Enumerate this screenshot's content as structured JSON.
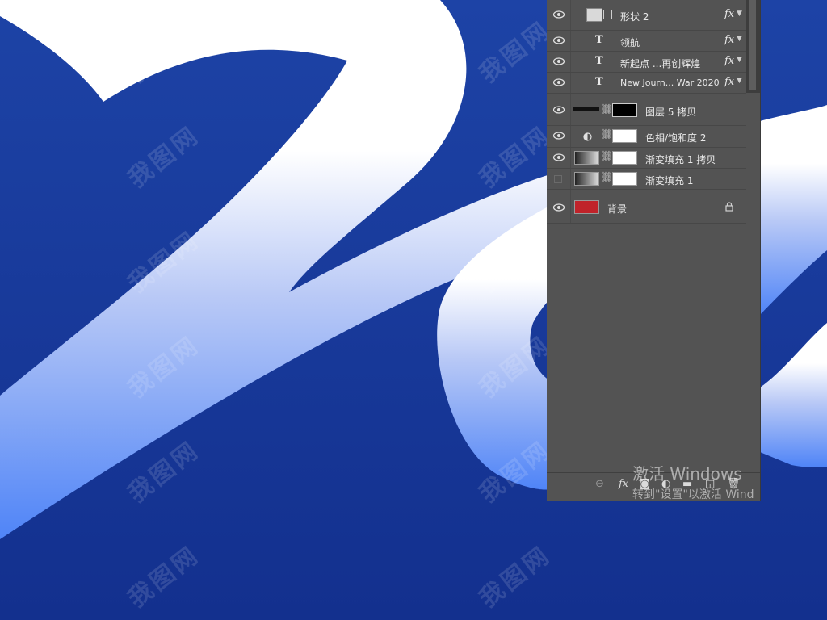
{
  "panel": {
    "layers": [
      {
        "name": "形状 2",
        "kind": "shape",
        "visible": true,
        "fx": "fx"
      },
      {
        "name": "领航",
        "kind": "text",
        "visible": true,
        "fx": "fx"
      },
      {
        "name": "新起点 ...再创辉煌",
        "kind": "text",
        "visible": true,
        "fx": "fx"
      },
      {
        "name": "New Journ... War 2020",
        "kind": "text",
        "visible": true,
        "fx": "fx"
      },
      {
        "name": "图层 5 拷贝",
        "kind": "masked",
        "visible": true
      },
      {
        "name": "色相/饱和度 2",
        "kind": "adjustment",
        "visible": true
      },
      {
        "name": "渐变填充 1 拷贝",
        "kind": "gradient",
        "visible": true
      },
      {
        "name": "渐变填充 1",
        "kind": "gradient",
        "visible": false
      },
      {
        "name": "背景",
        "kind": "background",
        "visible": true,
        "color": "#c0232a"
      }
    ],
    "bottom_icons": [
      "link-icon",
      "fx-icon",
      "mask-icon",
      "adjustment-icon",
      "folder-icon",
      "new-layer-icon",
      "trash-icon"
    ],
    "fx_label": "fx"
  },
  "windows_activation": {
    "line1": "激活 Windows",
    "line2": "转到\"设置\"以激活 Wind"
  },
  "colors": {
    "canvas_blue": "#1a3a9a",
    "panel_bg": "#535353",
    "background_swatch": "#c0232a"
  }
}
